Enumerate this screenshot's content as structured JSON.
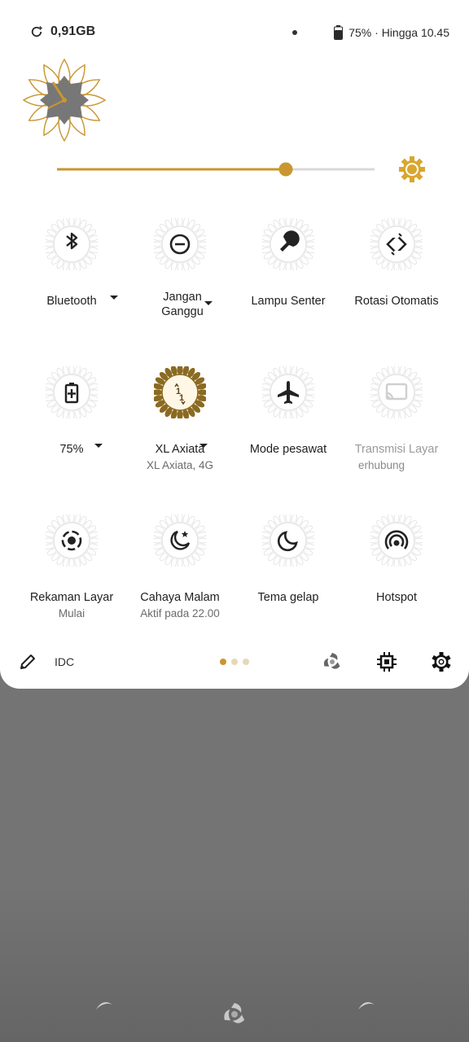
{
  "status_bar": {
    "storage": "0,91GB",
    "battery": "75% · Hingga 10.45"
  },
  "brightness": {
    "level": 0.72
  },
  "tiles": [
    {
      "label": "Bluetooth",
      "sub": "",
      "icon": "bluetooth-icon",
      "active": false,
      "dropdown": true
    },
    {
      "label": "Jangan Ganggu",
      "sub": "",
      "icon": "do-not-disturb-icon",
      "active": false,
      "dropdown": true
    },
    {
      "label": "Lampu Senter",
      "sub": "",
      "icon": "flashlight-icon",
      "active": false,
      "dropdown": false
    },
    {
      "label": "Rotasi Otomatis",
      "sub": "",
      "icon": "auto-rotate-icon",
      "active": false,
      "dropdown": false
    },
    {
      "label": "75%",
      "sub": "",
      "icon": "battery-saver-icon",
      "active": false,
      "dropdown": true
    },
    {
      "label": "XL Axiata",
      "sub": "XL Axiata, 4G",
      "icon": "mobile-data-icon",
      "active": true,
      "dropdown": true
    },
    {
      "label": "Mode pesawat",
      "sub": "",
      "icon": "airplane-icon",
      "active": false,
      "dropdown": false
    },
    {
      "label": "Transmisi Layar",
      "sub": "erhubung",
      "icon": "cast-icon",
      "active": false,
      "disabled": true,
      "dropdown": false
    },
    {
      "label": "Rekaman Layar",
      "sub": "Mulai",
      "icon": "screen-record-icon",
      "active": false,
      "dropdown": false
    },
    {
      "label": "Cahaya Malam",
      "sub": "Aktif pada 22.00",
      "icon": "night-light-icon",
      "active": false,
      "dropdown": false
    },
    {
      "label": "Tema gelap",
      "sub": "",
      "icon": "dark-theme-icon",
      "active": false,
      "dropdown": false
    },
    {
      "label": "Hotspot",
      "sub": "",
      "icon": "hotspot-icon",
      "active": false,
      "dropdown": false
    }
  ],
  "footer": {
    "carrier": "IDC",
    "pages": 3,
    "current_page": 0
  },
  "colors": {
    "accent": "#C9962F",
    "active_fill": "#8B6A22",
    "tile_ring": "#E6E6E6"
  }
}
